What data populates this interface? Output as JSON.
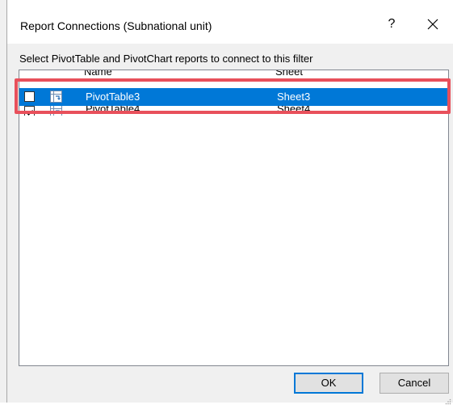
{
  "dialog": {
    "title": "Report Connections (Subnational unit)",
    "help_label": "?",
    "close_icon": "close-icon",
    "prompt": "Select PivotTable and PivotChart reports to connect to this filter"
  },
  "list": {
    "columns": [
      "Name",
      "Sheet"
    ],
    "rows": [
      {
        "name": "PivotTable3",
        "sheet": "Sheet3",
        "checked": false,
        "selected": true,
        "icon": "pivottable-icon"
      },
      {
        "name": "PivotTable4",
        "sheet": "Sheet4",
        "checked": true,
        "selected": false,
        "icon": "pivottable-icon"
      }
    ]
  },
  "buttons": {
    "ok_label": "OK",
    "cancel_label": "Cancel"
  },
  "colors": {
    "selection": "#0078d7",
    "highlight_box": "#e8505b",
    "dialog_bg": "#f0f0f0"
  }
}
